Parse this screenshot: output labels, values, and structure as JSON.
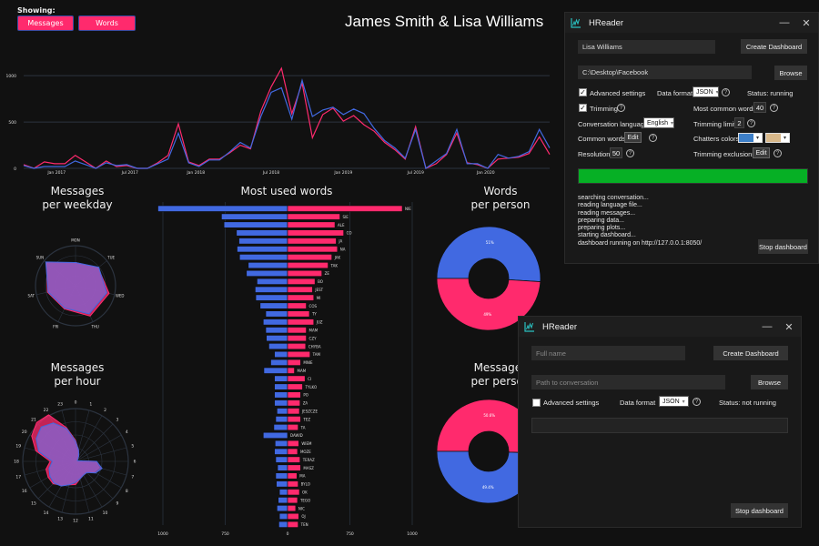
{
  "dashboard": {
    "showing_label": "Showing:",
    "filters": [
      {
        "label": "Messages",
        "active": true
      },
      {
        "label": "Words",
        "active": true
      }
    ],
    "title": "James Smith & Lisa Williams",
    "colors": {
      "person1": "#4169e1",
      "person2": "#ff2a6d",
      "overlap": "#8a5fc8",
      "grid": "#2c3440",
      "background": "#111111"
    },
    "persons": [
      "James Smith",
      "Lisa Williams"
    ]
  },
  "chart_data": [
    {
      "id": "timeline",
      "type": "line",
      "title": "",
      "xlabel": "",
      "ylabel": "",
      "ylim": [
        0,
        1100
      ],
      "yticks": [
        "0",
        "500",
        "1000"
      ],
      "ytick_values": [
        0,
        500,
        1000
      ],
      "xtick_labels": [
        "Jan 2017",
        "Jul 2017",
        "Jan 2018",
        "Jul 2018",
        "Jan 2019",
        "Jul 2019",
        "Jan 2020"
      ],
      "xtick_index": [
        3.2,
        10.3,
        16.7,
        24.0,
        31.0,
        38.0,
        44.8
      ],
      "grid": true,
      "series": [
        {
          "name": "James Smith",
          "color": "#4169e1",
          "values": [
            30,
            0,
            20,
            20,
            20,
            80,
            40,
            0,
            60,
            30,
            40,
            0,
            0,
            50,
            100,
            380,
            60,
            20,
            90,
            90,
            180,
            280,
            220,
            560,
            820,
            870,
            530,
            950,
            560,
            630,
            660,
            580,
            640,
            590,
            430,
            300,
            220,
            110,
            420,
            0,
            80,
            160,
            420,
            50,
            50,
            0,
            150,
            110,
            130,
            180,
            420,
            220
          ]
        },
        {
          "name": "Lisa Williams",
          "color": "#ff2a6d",
          "values": [
            40,
            0,
            70,
            50,
            50,
            140,
            70,
            0,
            80,
            20,
            30,
            0,
            0,
            60,
            140,
            480,
            70,
            30,
            100,
            100,
            170,
            250,
            210,
            620,
            880,
            1080,
            590,
            920,
            330,
            580,
            650,
            510,
            570,
            470,
            400,
            280,
            200,
            100,
            450,
            0,
            50,
            150,
            380,
            60,
            40,
            0,
            100,
            110,
            120,
            160,
            340,
            150
          ]
        }
      ]
    },
    {
      "id": "weekday",
      "type": "radar",
      "title": "Messages per weekday",
      "categories": [
        "MON",
        "TUE",
        "WED",
        "THU",
        "FRI",
        "SAT",
        "SUN"
      ],
      "rmax": 100,
      "series": [
        {
          "name": "James Smith",
          "values": [
            58,
            74,
            80,
            78,
            62,
            70,
            95
          ]
        },
        {
          "name": "Lisa Williams",
          "values": [
            58,
            72,
            86,
            84,
            64,
            72,
            93
          ]
        }
      ]
    },
    {
      "id": "hour",
      "type": "radar",
      "title": "Messages per hour",
      "categories": [
        "0",
        "1",
        "2",
        "3",
        "4",
        "5",
        "6",
        "7",
        "8",
        "9",
        "10",
        "11",
        "12",
        "13",
        "14",
        "15",
        "16",
        "17",
        "18",
        "19",
        "20",
        "21",
        "22",
        "23"
      ],
      "rmax": 100,
      "series": [
        {
          "name": "James Smith",
          "values": [
            38,
            22,
            12,
            6,
            4,
            4,
            40,
            52,
            44,
            30,
            30,
            34,
            40,
            46,
            54,
            58,
            56,
            52,
            44,
            72,
            86,
            92,
            84,
            64
          ]
        },
        {
          "name": "Lisa Williams",
          "values": [
            40,
            22,
            12,
            6,
            4,
            4,
            38,
            46,
            40,
            30,
            30,
            34,
            44,
            46,
            52,
            60,
            60,
            58,
            48,
            78,
            96,
            104,
            102,
            66
          ]
        }
      ]
    },
    {
      "id": "words",
      "type": "bar",
      "title": "Most used words",
      "orientation": "horizontal-butterfly",
      "xlim": [
        -1000,
        1000
      ],
      "xtick_labels": [
        "1000",
        "750",
        "0",
        "750",
        "1000"
      ],
      "xtick_values": [
        -1000,
        -500,
        0,
        500,
        1000
      ],
      "categories": [
        "NIE",
        "SIE",
        "ALE",
        "CO",
        "JA",
        "NA",
        "JAK",
        "TAK",
        "ZE",
        "BO",
        "JEST",
        "MI",
        "COS",
        "TY",
        "JUZ",
        "MAM",
        "CZY",
        "CHYBA",
        "TAM",
        "MNIE",
        "MAM",
        "CI",
        "TYLKO",
        "PO",
        "ZA",
        "JESZCZE",
        "TEZ",
        "TA",
        "DAWID",
        "WIEM",
        "MOZE",
        "TERAZ",
        "MASZ",
        "MA",
        "BYLO",
        "OK",
        "TEGO",
        "NIC",
        "OJ",
        "TEN"
      ],
      "series": [
        {
          "name": "James Smith",
          "values": [
            1040,
            530,
            510,
            410,
            390,
            405,
            385,
            315,
            330,
            245,
            260,
            255,
            220,
            175,
            195,
            175,
            170,
            150,
            105,
            135,
            190,
            105,
            105,
            105,
            105,
            85,
            95,
            110,
            195,
            100,
            105,
            95,
            80,
            95,
            90,
            65,
            75,
            85,
            65,
            70
          ]
        },
        {
          "name": "Lisa Williams",
          "values": [
            920,
            420,
            380,
            450,
            390,
            400,
            355,
            325,
            275,
            220,
            200,
            210,
            150,
            175,
            210,
            150,
            150,
            145,
            180,
            105,
            55,
            140,
            120,
            105,
            100,
            95,
            105,
            85,
            0,
            90,
            80,
            100,
            105,
            75,
            85,
            95,
            80,
            65,
            90,
            85
          ]
        }
      ]
    },
    {
      "id": "words-per-person",
      "type": "pie",
      "title": "Words per person",
      "hole": true,
      "labels": [
        "James Smith",
        "Lisa Williams"
      ],
      "values": [
        51,
        49
      ],
      "data_labels": [
        "51%",
        "49%"
      ]
    },
    {
      "id": "messages-per-person",
      "type": "pie",
      "title": "Messages per person",
      "hole": true,
      "labels": [
        "James Smith",
        "Lisa Williams"
      ],
      "values": [
        49.4,
        50.6
      ],
      "data_labels": [
        "49.4%",
        "50.6%"
      ]
    }
  ],
  "section_titles": {
    "weekday": [
      "Messages",
      "per weekday"
    ],
    "hour": [
      "Messages",
      "per hour"
    ],
    "words": "Most used words",
    "words_pp": [
      "Words",
      "per person"
    ],
    "messages_pp": [
      "Messages",
      "per person"
    ]
  },
  "window_running": {
    "title": "HReader",
    "minimize": "—",
    "close": "✕",
    "name_value": "Lisa Williams",
    "create_button": "Create Dashboard",
    "path_value": "C:\\Desktop\\Facebook",
    "browse_button": "Browse",
    "advanced_label": "Advanced settings",
    "advanced_checked": true,
    "data_format_label": "Data format",
    "data_format_value": "JSON",
    "status": "Status: running",
    "trimming_label": "Trimming",
    "trimming_checked": true,
    "most_common_label": "Most common words",
    "most_common_value": "40",
    "language_label": "Conversation language",
    "language_value": "English",
    "trimming_limit_label": "Trimming limit",
    "trimming_limit_value": "2",
    "common_words_label": "Common words",
    "edit_label": "Edit",
    "chatters_colors_label": "Chatters colors",
    "chatter_color_1": "#3d7fc8",
    "chatter_color_2": "#d8b88a",
    "resolution_label": "Resolution",
    "resolution_value": "50",
    "trimming_exclusions_label": "Trimming exclusions",
    "progress": 1.0,
    "log": "searching conversation...\nreading language file...\nreading messages...\npreparing data...\npreparing plots...\nstarting dashboard...\ndashboard running on http://127.0.0.1:8050/",
    "stop_button": "Stop dashboard",
    "help": "?"
  },
  "window_idle": {
    "title": "HReader",
    "minimize": "—",
    "close": "✕",
    "name_placeholder": "Full name",
    "create_button": "Create Dashboard",
    "path_placeholder": "Path to conversation",
    "browse_button": "Browse",
    "advanced_label": "Advanced settings",
    "advanced_checked": false,
    "data_format_label": "Data format",
    "data_format_value": "JSON",
    "status": "Status: not running",
    "progress": 0,
    "stop_button": "Stop dashboard",
    "help": "?"
  }
}
